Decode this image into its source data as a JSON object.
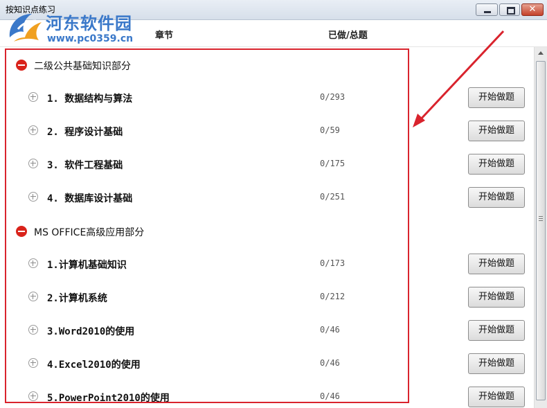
{
  "window": {
    "title": "按知识点练习",
    "close_label": "✕"
  },
  "watermark": {
    "name": "河东软件园",
    "url": "www.pc0359.cn"
  },
  "header": {
    "chapter_label": "章节",
    "done_total_label": "已做/总题"
  },
  "sections": [
    {
      "title": "二级公共基础知识部分",
      "items": [
        {
          "title": "1. 数据结构与算法",
          "count": "0/293",
          "button": "开始做题"
        },
        {
          "title": "2. 程序设计基础",
          "count": "0/59",
          "button": "开始做题"
        },
        {
          "title": "3. 软件工程基础",
          "count": "0/175",
          "button": "开始做题"
        },
        {
          "title": "4. 数据库设计基础",
          "count": "0/251",
          "button": "开始做题"
        }
      ]
    },
    {
      "title": "MS OFFICE高级应用部分",
      "items": [
        {
          "title": "1.计算机基础知识",
          "count": "0/173",
          "button": "开始做题"
        },
        {
          "title": "2.计算机系统",
          "count": "0/212",
          "button": "开始做题"
        },
        {
          "title": "3.Word2010的使用",
          "count": "0/46",
          "button": "开始做题"
        },
        {
          "title": "4.Excel2010的使用",
          "count": "0/46",
          "button": "开始做题"
        },
        {
          "title": "5.PowerPoint2010的使用",
          "count": "0/46",
          "button": "开始做题"
        }
      ]
    }
  ],
  "colors": {
    "accent_red": "#d9232d",
    "watermark_blue": "#3a78c9"
  }
}
